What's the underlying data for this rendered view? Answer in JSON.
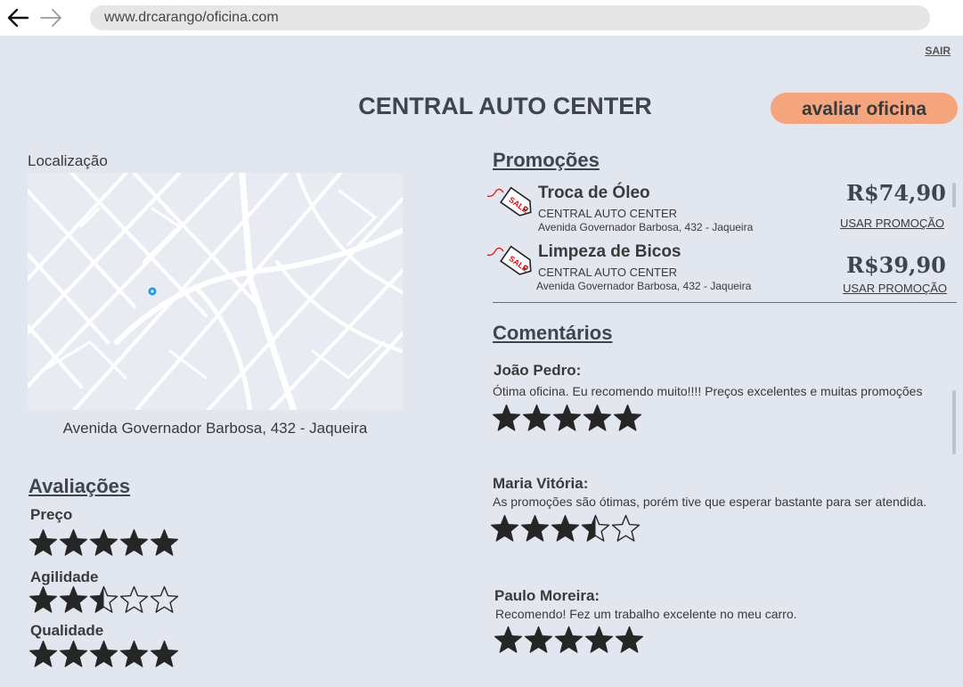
{
  "browser": {
    "back_icon": "arrow-left-icon",
    "forward_icon": "arrow-right-icon",
    "url": "www.drcarango/oficina.com"
  },
  "header": {
    "logout_label": "SAIR",
    "title": "CENTRAL AUTO CENTER",
    "rate_button_label": "avaliar oficina",
    "rate_button_color": "#f4a57d"
  },
  "location": {
    "label": "Localização",
    "address": "Avenida Governador Barbosa, 432 - Jaqueira",
    "marker_color": "#1e9be8"
  },
  "ratings": {
    "title": "Avaliações",
    "items": [
      {
        "label": "Preço",
        "stars": 5
      },
      {
        "label": "Agilidade",
        "stars": 2.5
      },
      {
        "label": "Qualidade",
        "stars": 5
      }
    ]
  },
  "promotions": {
    "title": "Promoções",
    "icon": "sale-tag-icon",
    "use_label": "USAR PROMOÇÃO",
    "items": [
      {
        "name": "Troca de Óleo",
        "shop": "CENTRAL AUTO CENTER",
        "address": "Avenida Governador Barbosa, 432 - Jaqueira",
        "price": "R$74,90",
        "use_label": "USAR PROMOÇÃO"
      },
      {
        "name": "Limpeza de Bicos",
        "shop": "CENTRAL AUTO CENTER",
        "address": "Avenida Governador Barbosa, 432 - Jaqueira",
        "price": "R$39,90",
        "use_label": "USAR PROMOÇÃO"
      }
    ]
  },
  "comments": {
    "title": "Comentários",
    "items": [
      {
        "author": "João Pedro:",
        "text": "Ótima oficina. Eu recomendo muito!!!! Preços excelentes e muitas promoções",
        "stars": 5
      },
      {
        "author": "Maria Vitória:",
        "text": "As promoções são ótimas, porém tive que esperar bastante para ser atendida.",
        "stars": 3.5
      },
      {
        "author": "Paulo Moreira:",
        "text": "Recomendo! Fez um trabalho excelente no meu carro.",
        "stars": 5
      }
    ]
  }
}
